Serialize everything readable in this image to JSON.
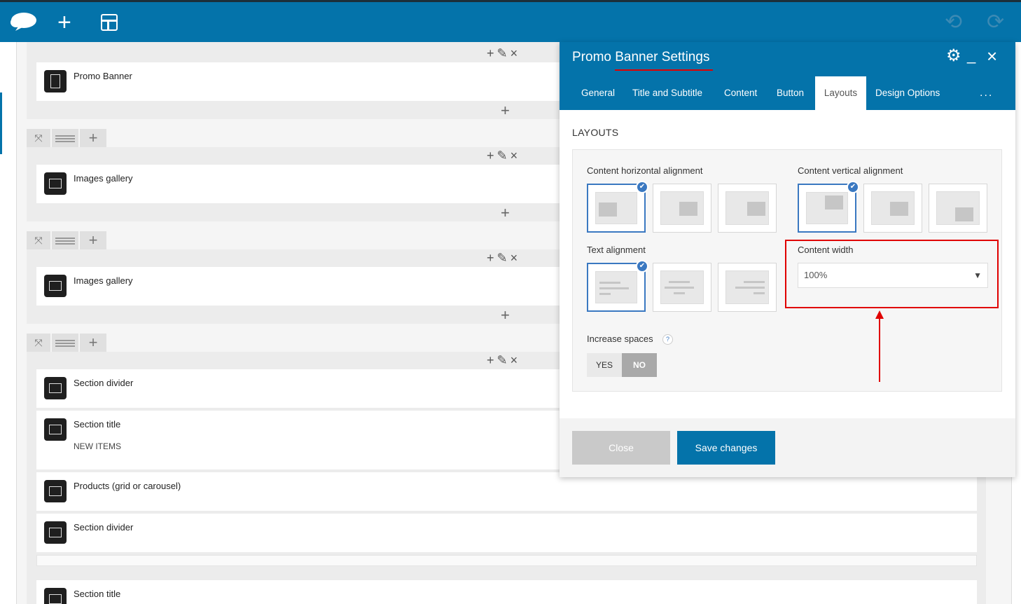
{
  "topbar": {
    "add_label": "+",
    "undo_label": "⟲",
    "redo_label": "⟳",
    "icons": [
      "cloud-logo-icon",
      "plus-icon",
      "layout-icon",
      "undo-icon",
      "redo-icon"
    ]
  },
  "builder": {
    "row_add": "+",
    "col_add": "+",
    "col_edit": "✎",
    "col_delete": "×",
    "elements": [
      {
        "name": "Promo Banner",
        "icon": "promo-banner-icon"
      },
      {
        "name": "Images gallery",
        "icon": "image-gallery-icon"
      },
      {
        "name": "Images gallery",
        "icon": "image-gallery-icon"
      },
      {
        "name": "Section divider",
        "icon": "section-divider-icon"
      },
      {
        "name": "Section title",
        "sub": "NEW ITEMS",
        "icon": "section-title-icon"
      },
      {
        "name": "Products (grid or carousel)",
        "icon": "products-icon"
      },
      {
        "name": "Section divider",
        "icon": "section-divider-icon"
      },
      {
        "name": "Section title",
        "icon": "section-title-icon"
      }
    ]
  },
  "panel": {
    "title": "Promo Banner Settings",
    "tabs": [
      {
        "label": "General"
      },
      {
        "label": "Title and Subtitle"
      },
      {
        "label": "Content"
      },
      {
        "label": "Button"
      },
      {
        "label": "Layouts",
        "active": true
      },
      {
        "label": "Design Options"
      }
    ],
    "tabs_more": "...",
    "section_heading": "LAYOUTS",
    "h_align_label": "Content horizontal alignment",
    "v_align_label": "Content vertical alignment",
    "text_align_label": "Text alignment",
    "content_width_label": "Content width",
    "content_width_value": "100%",
    "increase_spaces_label": "Increase spaces",
    "help": "?",
    "yes": "YES",
    "no": "NO",
    "close": "Close",
    "save": "Save changes",
    "accent_color": "#0473aa",
    "selected_color": "#3a78c1"
  }
}
